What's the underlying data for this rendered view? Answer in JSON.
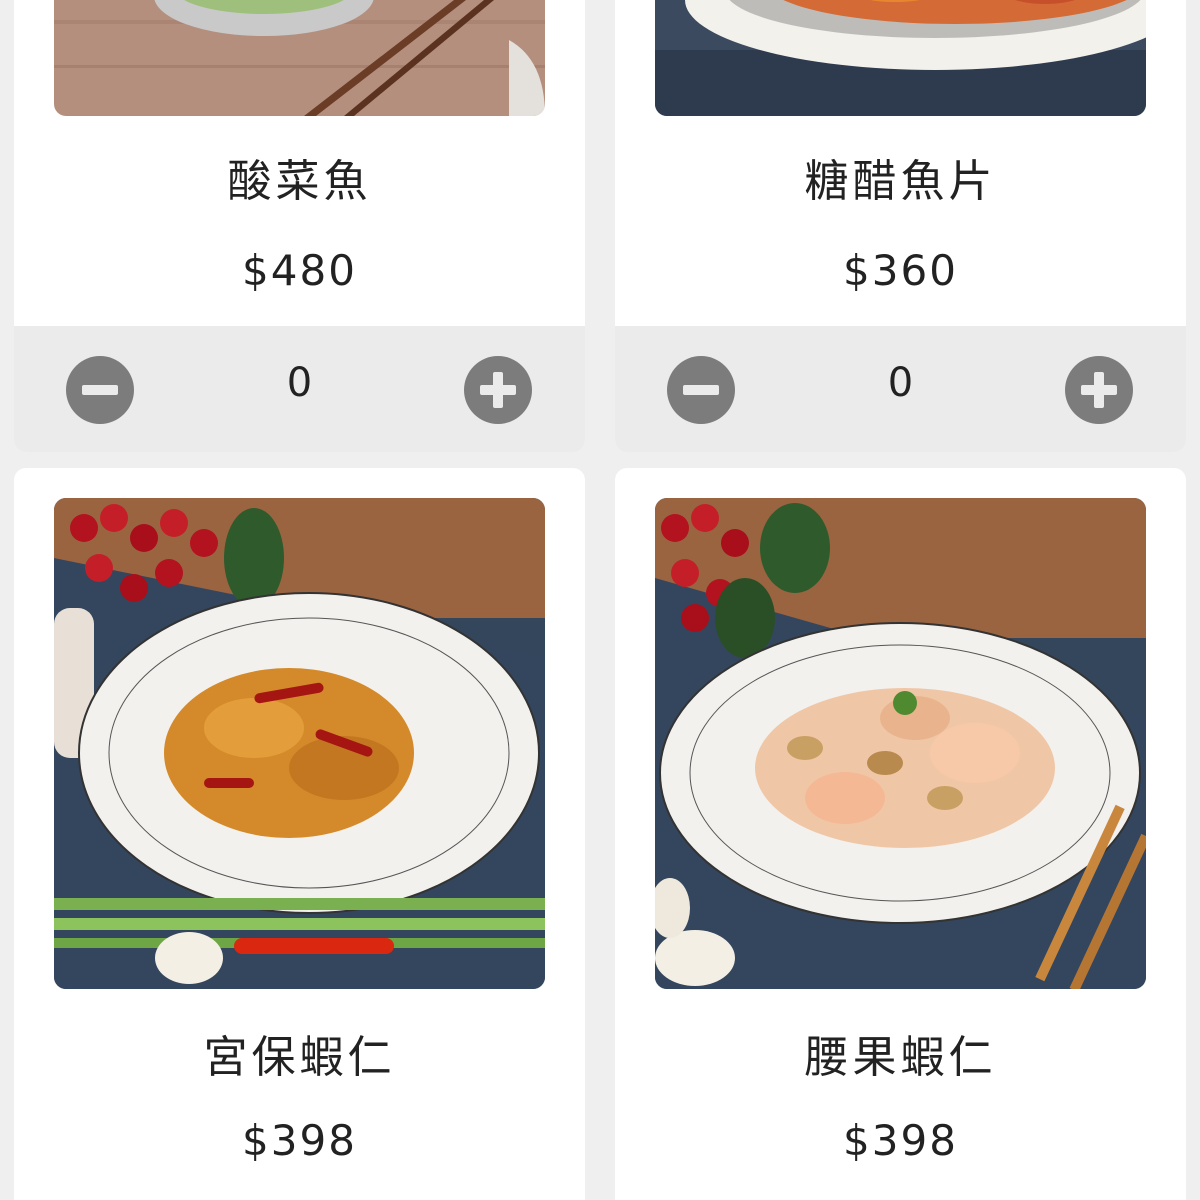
{
  "menu": {
    "items": [
      {
        "name": "酸菜魚",
        "price": "$480",
        "quantity": "0",
        "photo": "suancai-fish-photo"
      },
      {
        "name": "糖醋魚片",
        "price": "$360",
        "quantity": "0",
        "photo": "sweet-sour-fish-photo"
      },
      {
        "name": "宮保蝦仁",
        "price": "$398",
        "photo": "kung-pao-shrimp-photo"
      },
      {
        "name": "腰果蝦仁",
        "price": "$398",
        "photo": "cashew-shrimp-photo"
      }
    ]
  },
  "icons": {
    "decrement": "minus-circle-icon",
    "increment": "plus-circle-icon"
  },
  "colors": {
    "page_background": "#efefef",
    "card_background": "#ffffff",
    "stepper_background": "#ebebeb",
    "stepper_button": "#7c7c7c",
    "text": "#222222"
  }
}
